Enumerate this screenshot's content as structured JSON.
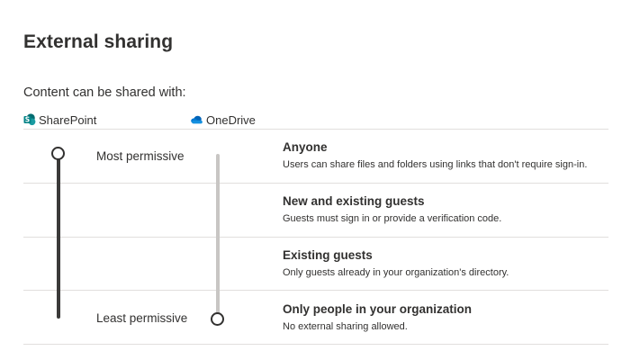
{
  "page": {
    "title": "External sharing",
    "section_label": "Content can be shared with:"
  },
  "products": {
    "sharepoint": {
      "label": "SharePoint",
      "icon": "sharepoint-icon"
    },
    "onedrive": {
      "label": "OneDrive",
      "icon": "onedrive-icon"
    }
  },
  "scale": {
    "most_label": "Most permissive",
    "least_label": "Least permissive"
  },
  "options": [
    {
      "title": "Anyone",
      "description": "Users can share files and folders using links that don't require sign-in."
    },
    {
      "title": "New and existing guests",
      "description": "Guests must sign in or provide a verification code."
    },
    {
      "title": "Existing guests",
      "description": "Only guests already in your organization's directory."
    },
    {
      "title": "Only people in your organization",
      "description": "No external sharing allowed."
    }
  ],
  "sliders": {
    "sharepoint_selected": "Anyone",
    "onedrive_selected": "Only people in your organization"
  },
  "colors": {
    "sharepoint_teal": "#038387",
    "onedrive_blue": "#0364b8",
    "active_track": "#3b3a39",
    "inactive_track": "#c8c6c4",
    "divider": "#e1dfdd"
  }
}
